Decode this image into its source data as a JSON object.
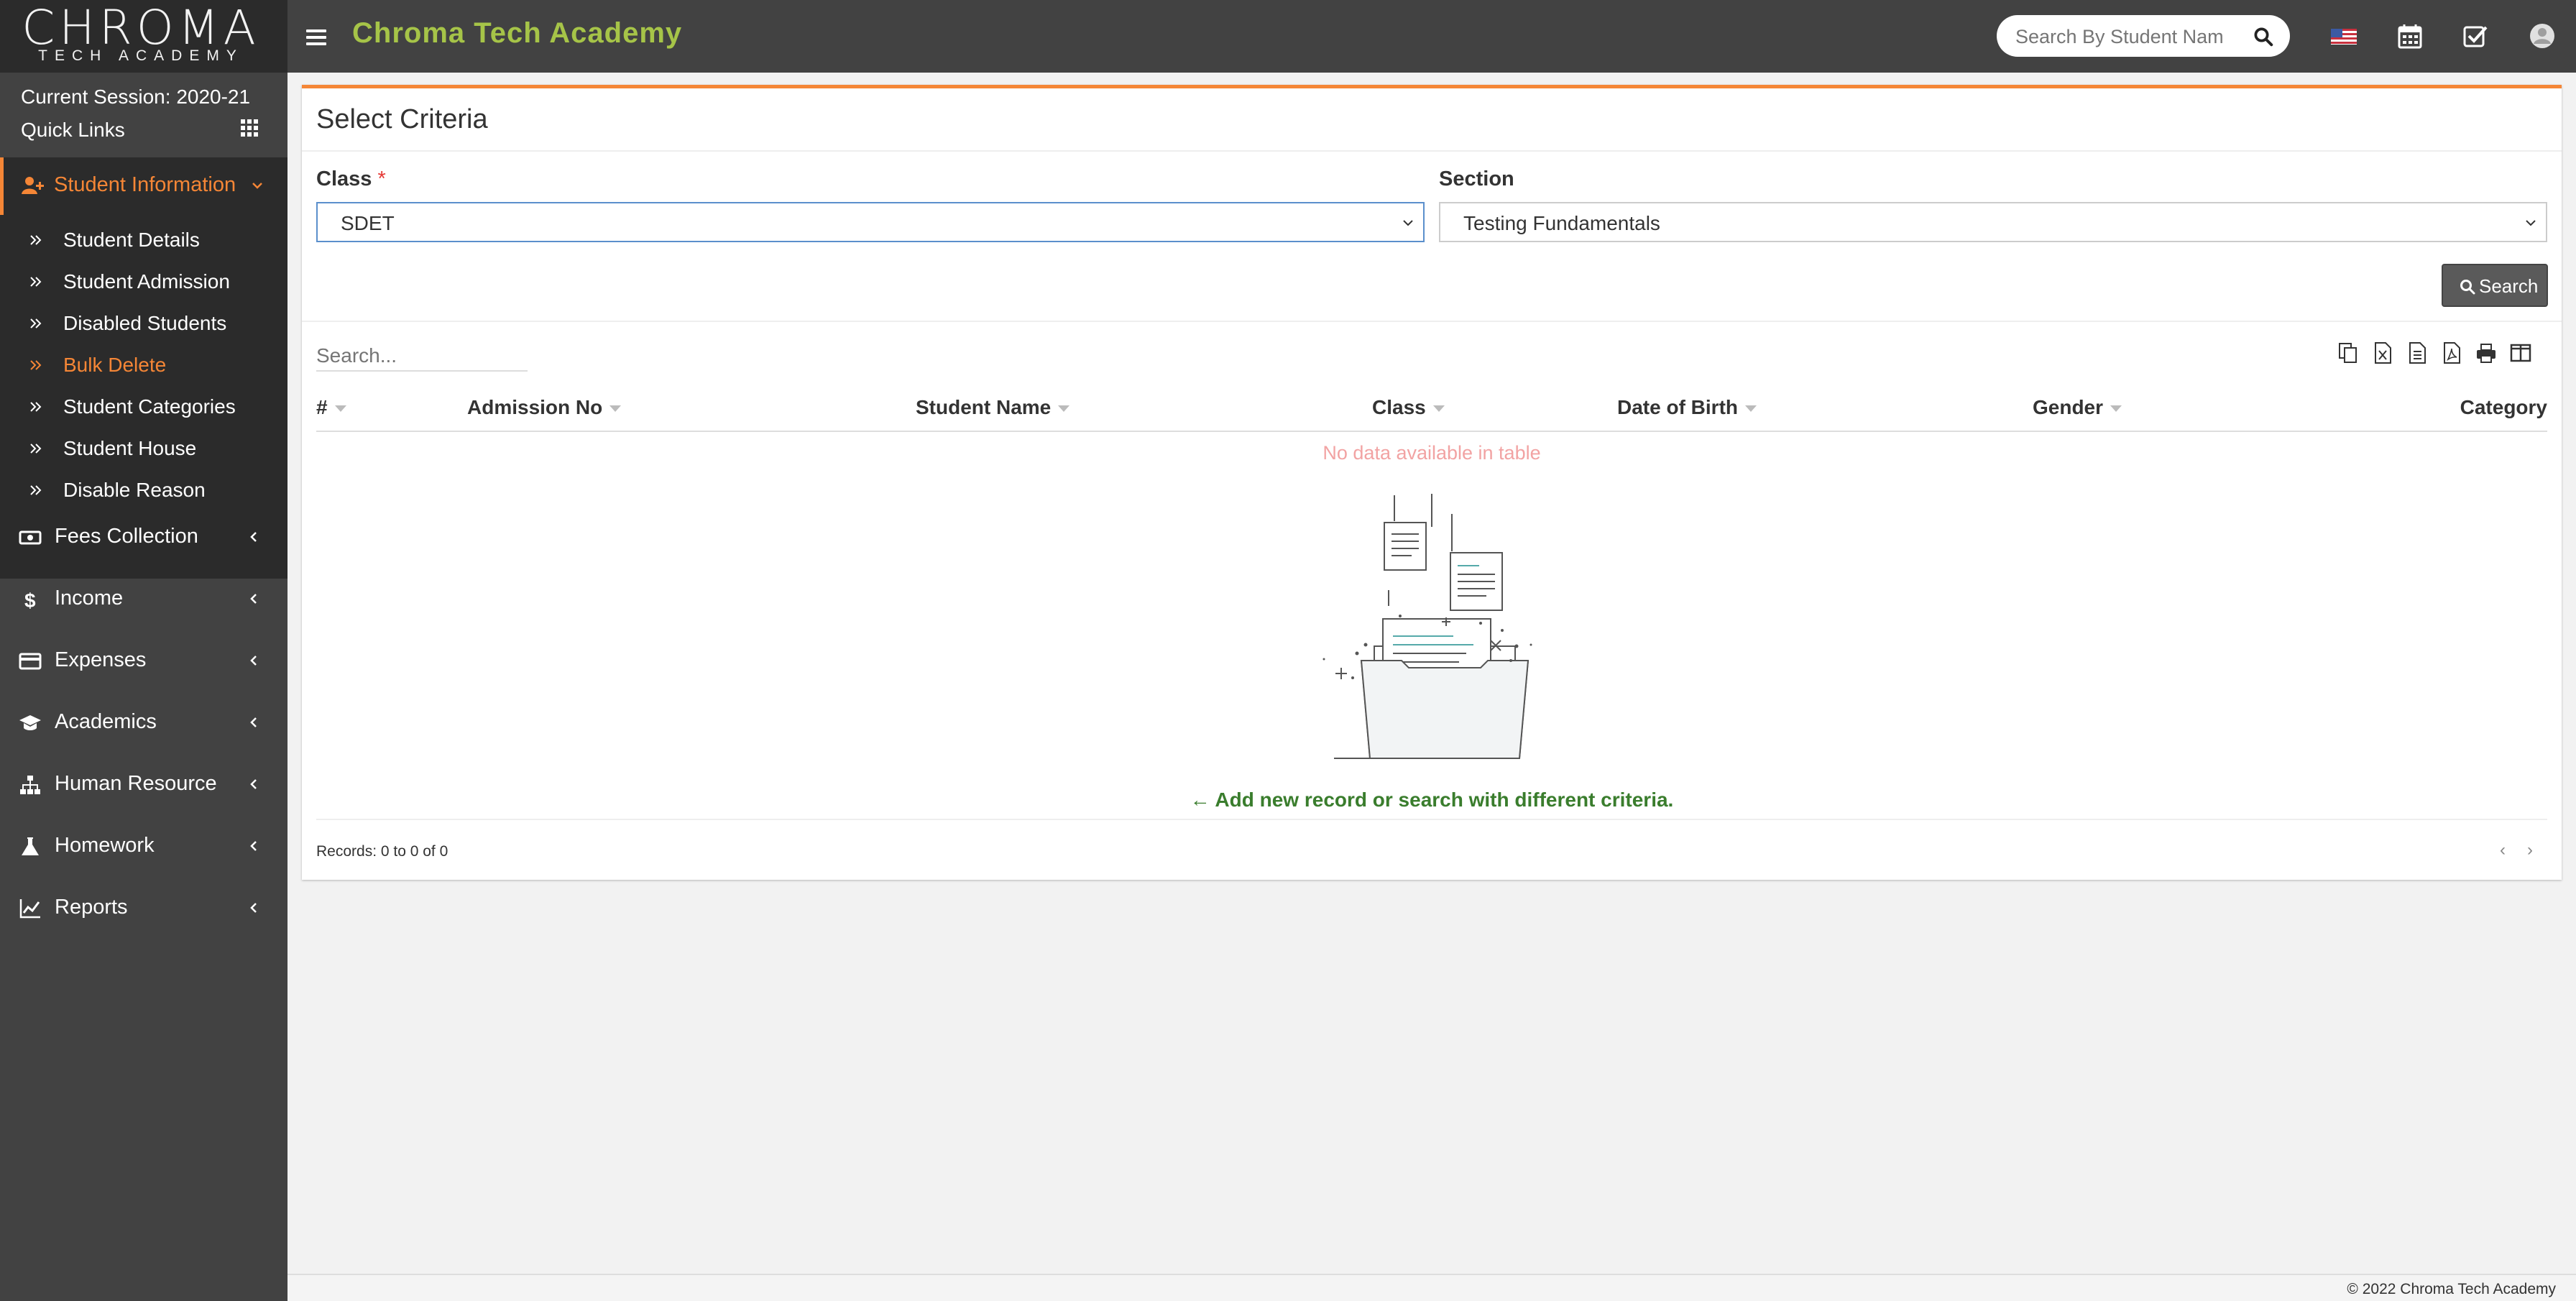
{
  "header": {
    "logo_main": "CHROMA",
    "logo_sub": "TECH ACADEMY",
    "app_title": "Chroma Tech Academy",
    "search_placeholder": "Search By Student Nam",
    "icons": [
      "menu-icon",
      "search-icon",
      "us-flag-icon",
      "calendar-icon",
      "task-check-icon",
      "user-avatar-icon"
    ]
  },
  "sidebar": {
    "session": "Current Session: 2020-21",
    "quick_links": "Quick Links",
    "active_menu": {
      "label": "Student Information",
      "icon": "user-plus-icon"
    },
    "submenu": [
      {
        "label": "Student Details",
        "active": false
      },
      {
        "label": "Student Admission",
        "active": false
      },
      {
        "label": "Disabled Students",
        "active": false
      },
      {
        "label": "Bulk Delete",
        "active": true
      },
      {
        "label": "Student Categories",
        "active": false
      },
      {
        "label": "Student House",
        "active": false
      },
      {
        "label": "Disable Reason",
        "active": false
      }
    ],
    "menu": [
      {
        "label": "Fees Collection",
        "icon": "money-icon"
      },
      {
        "label": "Income",
        "icon": "dollar-icon"
      },
      {
        "label": "Expenses",
        "icon": "credit-card-icon"
      },
      {
        "label": "Academics",
        "icon": "graduation-cap-icon"
      },
      {
        "label": "Human Resource",
        "icon": "sitemap-icon"
      },
      {
        "label": "Homework",
        "icon": "flask-icon"
      },
      {
        "label": "Reports",
        "icon": "line-chart-icon"
      }
    ]
  },
  "criteria": {
    "title": "Select Criteria",
    "class_label": "Class",
    "required_mark": "*",
    "class_value": "SDET",
    "section_label": "Section",
    "section_value": "Testing Fundamentals",
    "search_button": "Search"
  },
  "table": {
    "search_placeholder": "Search...",
    "columns": [
      "#",
      "Admission No",
      "Student Name",
      "Class",
      "Date of Birth",
      "Gender",
      "Category"
    ],
    "tools": [
      "copy-icon",
      "excel-icon",
      "csv-icon",
      "pdf-icon",
      "print-icon",
      "columns-icon"
    ],
    "empty_text": "No data available in table",
    "add_message": "Add new record or search with different criteria.",
    "records_info": "Records: 0 to 0 of 0",
    "pager_prev": "‹",
    "pager_next": "›"
  },
  "footer": {
    "copyright": "© 2022 Chroma Tech Academy"
  },
  "colors": {
    "accent_orange": "#f58636",
    "title_green": "#a6c448",
    "sidebar_bg": "#424242",
    "sidebar_dark": "#2b2b2b",
    "empty_text": "#f2a3a3",
    "add_message_green": "#3a7d2d"
  }
}
